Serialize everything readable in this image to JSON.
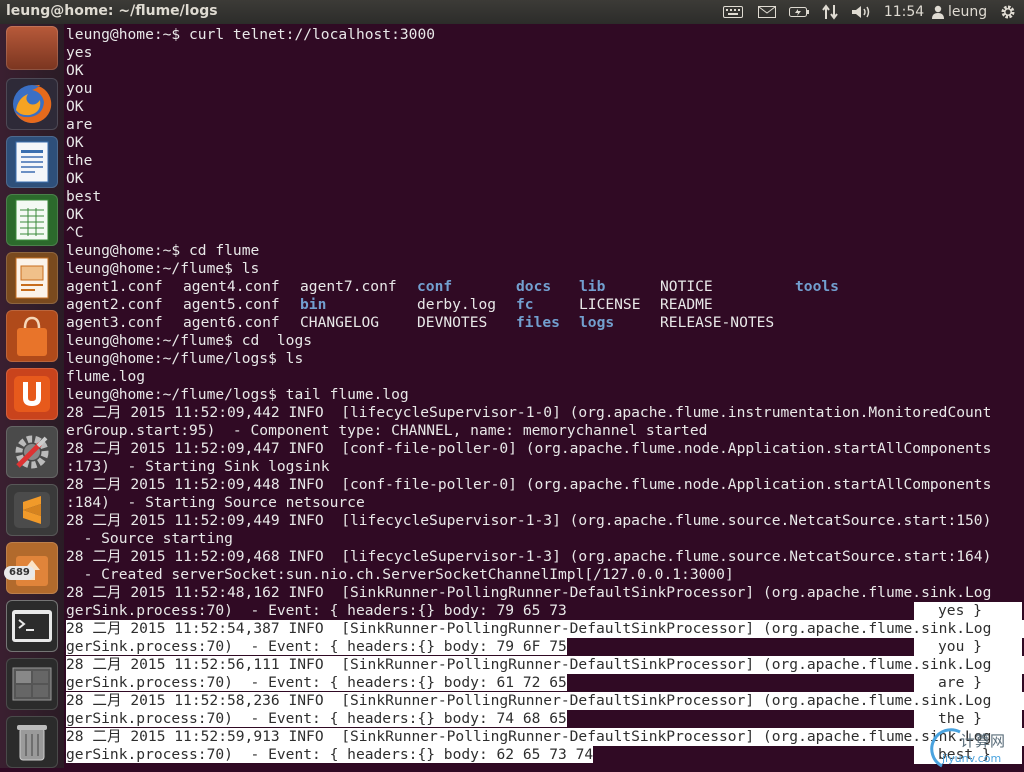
{
  "panel": {
    "window_title": "leung@home: ~/flume/logs",
    "clock": "11:54",
    "user": "leung"
  },
  "launcher": {
    "items": [
      "dash-home",
      "firefox",
      "libreoffice-writer",
      "libreoffice-calc",
      "libreoffice-impress",
      "ubuntu-software-center",
      "ubuntu-one",
      "system-settings",
      "sublime-text",
      "update-manager",
      "terminal",
      "workspace-switcher",
      "trash"
    ],
    "update_badge": "689"
  },
  "terminal": {
    "lines": [
      "leung@home:~$ curl telnet://localhost:3000",
      "yes",
      "OK",
      "you",
      "OK",
      "are",
      "OK",
      "the",
      "OK",
      "best",
      "OK",
      "^C",
      "leung@home:~$ cd flume",
      "leung@home:~/flume$ ls"
    ],
    "ls_rows": [
      [
        "agent1.conf",
        "agent4.conf",
        "agent7.conf",
        "conf",
        "docs",
        "lib",
        "NOTICE",
        "tools"
      ],
      [
        "agent2.conf",
        "agent5.conf",
        "bin",
        "derby.log",
        "fc",
        "LICENSE",
        "README",
        ""
      ],
      [
        "agent3.conf",
        "agent6.conf",
        "CHANGELOG",
        "DEVNOTES",
        "files",
        "logs",
        "RELEASE-NOTES",
        ""
      ]
    ],
    "lines2": [
      "leung@home:~/flume$ cd  logs",
      "leung@home:~/flume/logs$ ls",
      "flume.log",
      "leung@home:~/flume/logs$ tail flume.log",
      "28 二月 2015 11:52:09,442 INFO  [lifecycleSupervisor-1-0] (org.apache.flume.instrumentation.MonitoredCount",
      "erGroup.start:95)  - Component type: CHANNEL, name: memorychannel started",
      "28 二月 2015 11:52:09,447 INFO  [conf-file-poller-0] (org.apache.flume.node.Application.startAllComponents",
      ":173)  - Starting Sink logsink",
      "28 二月 2015 11:52:09,448 INFO  [conf-file-poller-0] (org.apache.flume.node.Application.startAllComponents",
      ":184)  - Starting Source netsource",
      "28 二月 2015 11:52:09,449 INFO  [lifecycleSupervisor-1-3] (org.apache.flume.source.NetcatSource.start:150)",
      "  - Source starting",
      "28 二月 2015 11:52:09,468 INFO  [lifecycleSupervisor-1-3] (org.apache.flume.source.NetcatSource.start:164)",
      "  - Created serverSocket:sun.nio.ch.ServerSocketChannelImpl[/127.0.0.1:3000]",
      "28 二月 2015 11:52:48,162 INFO  [SinkRunner-PollingRunner-DefaultSinkProcessor] (org.apache.flume.sink.Log",
      "gerSink.process:70)  - Event: { headers:{} body: 79 65 73"
    ],
    "events": [
      {
        "l1": "28 二月 2015 11:52:54,387 INFO  [SinkRunner-PollingRunner-DefaultSinkProcessor] (org.apache.flume.sink.Log",
        "l2": "gerSink.process:70)  - Event: { headers:{} body: 79 6F 75",
        "tail": "you }"
      },
      {
        "l1": "28 二月 2015 11:52:56,111 INFO  [SinkRunner-PollingRunner-DefaultSinkProcessor] (org.apache.flume.sink.Log",
        "l2": "gerSink.process:70)  - Event: { headers:{} body: 61 72 65",
        "tail": "are }"
      },
      {
        "l1": "28 二月 2015 11:52:58,236 INFO  [SinkRunner-PollingRunner-DefaultSinkProcessor] (org.apache.flume.sink.Log",
        "l2": "gerSink.process:70)  - Event: { headers:{} body: 74 68 65",
        "tail": "the }"
      },
      {
        "l1": "28 二月 2015 11:52:59,913 INFO  [SinkRunner-PollingRunner-DefaultSinkProcessor] (org.apache.flume.sink.Log",
        "l2": "gerSink.process:70)  - Event: { headers:{} body: 62 65 73 74",
        "tail": "best }"
      }
    ],
    "first_tail": "yes }"
  },
  "watermark": {
    "text": "计算网",
    "sub": "jiyunv.com"
  },
  "colors": {
    "terminal_bg": "#300a24",
    "directory": "#729fcf",
    "panel_bg": "#3c3b37"
  }
}
